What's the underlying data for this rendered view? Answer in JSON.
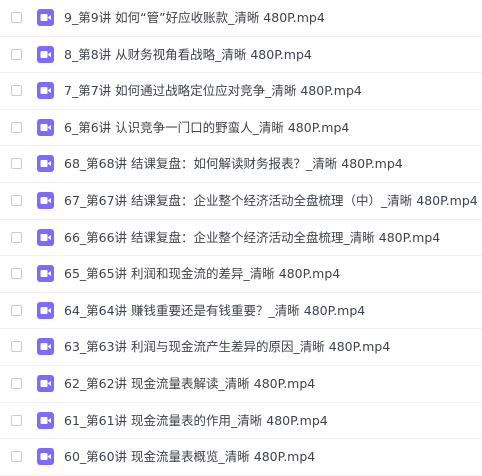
{
  "icon_color": "#7b6bff",
  "file_list": {
    "items": [
      {
        "name": "9_第9讲 如何“管”好应收账款_清晰 480P.mp4",
        "icon": "video-file-icon",
        "checked": false
      },
      {
        "name": "8_第8讲 从财务视角看战略_清晰 480P.mp4",
        "icon": "video-file-icon",
        "checked": false
      },
      {
        "name": "7_第7讲 如何通过战略定位应对竞争_清晰 480P.mp4",
        "icon": "video-file-icon",
        "checked": false
      },
      {
        "name": "6_第6讲 认识竞争一门口的野蛮人_清晰 480P.mp4",
        "icon": "video-file-icon",
        "checked": false
      },
      {
        "name": "68_第68讲 结课复盘：如何解读财务报表？_清晰 480P.mp4",
        "icon": "video-file-icon",
        "checked": false
      },
      {
        "name": "67_第67讲 结课复盘：企业整个经济活动全盘梳理（中）_清晰 480P.mp4",
        "icon": "video-file-icon",
        "checked": false
      },
      {
        "name": "66_第66讲 结课复盘：企业整个经济活动全盘梳理_清晰 480P.mp4",
        "icon": "video-file-icon",
        "checked": false
      },
      {
        "name": "65_第65讲 利润和现金流的差异_清晰 480P.mp4",
        "icon": "video-file-icon",
        "checked": false
      },
      {
        "name": "64_第64讲 赚钱重要还是有钱重要？_清晰 480P.mp4",
        "icon": "video-file-icon",
        "checked": false
      },
      {
        "name": "63_第63讲 利润与现金流产生差异的原因_清晰 480P.mp4",
        "icon": "video-file-icon",
        "checked": false
      },
      {
        "name": "62_第62讲 现金流量表解读_清晰 480P.mp4",
        "icon": "video-file-icon",
        "checked": false
      },
      {
        "name": "61_第61讲 现金流量表的作用_清晰 480P.mp4",
        "icon": "video-file-icon",
        "checked": false
      },
      {
        "name": "60_第60讲 现金流量表概览_清晰 480P.mp4",
        "icon": "video-file-icon",
        "checked": false
      }
    ]
  }
}
